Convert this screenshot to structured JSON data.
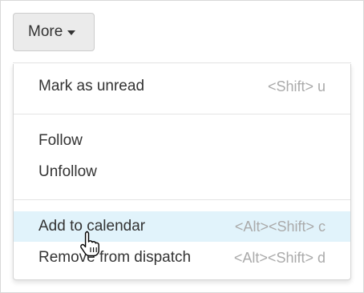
{
  "toolbar": {
    "more_label": "More",
    "caret_icon": "caret-down-icon"
  },
  "menu": {
    "items": [
      {
        "label": "Mark as unread",
        "shortcut": "<Shift> u",
        "highlighted": false
      },
      {
        "label": "Follow",
        "shortcut": "",
        "highlighted": false
      },
      {
        "label": "Unfollow",
        "shortcut": "",
        "highlighted": false
      },
      {
        "label": "Add to calendar",
        "shortcut": "<Alt><Shift> c",
        "highlighted": true
      },
      {
        "label": "Remove from dispatch",
        "shortcut": "<Alt><Shift> d",
        "highlighted": false
      }
    ]
  },
  "colors": {
    "highlight": "#e1f3fb",
    "shortcut_text": "#aaaaaa",
    "button_bg": "#ebebeb"
  },
  "cursor_icon": "hand-pointer-icon"
}
